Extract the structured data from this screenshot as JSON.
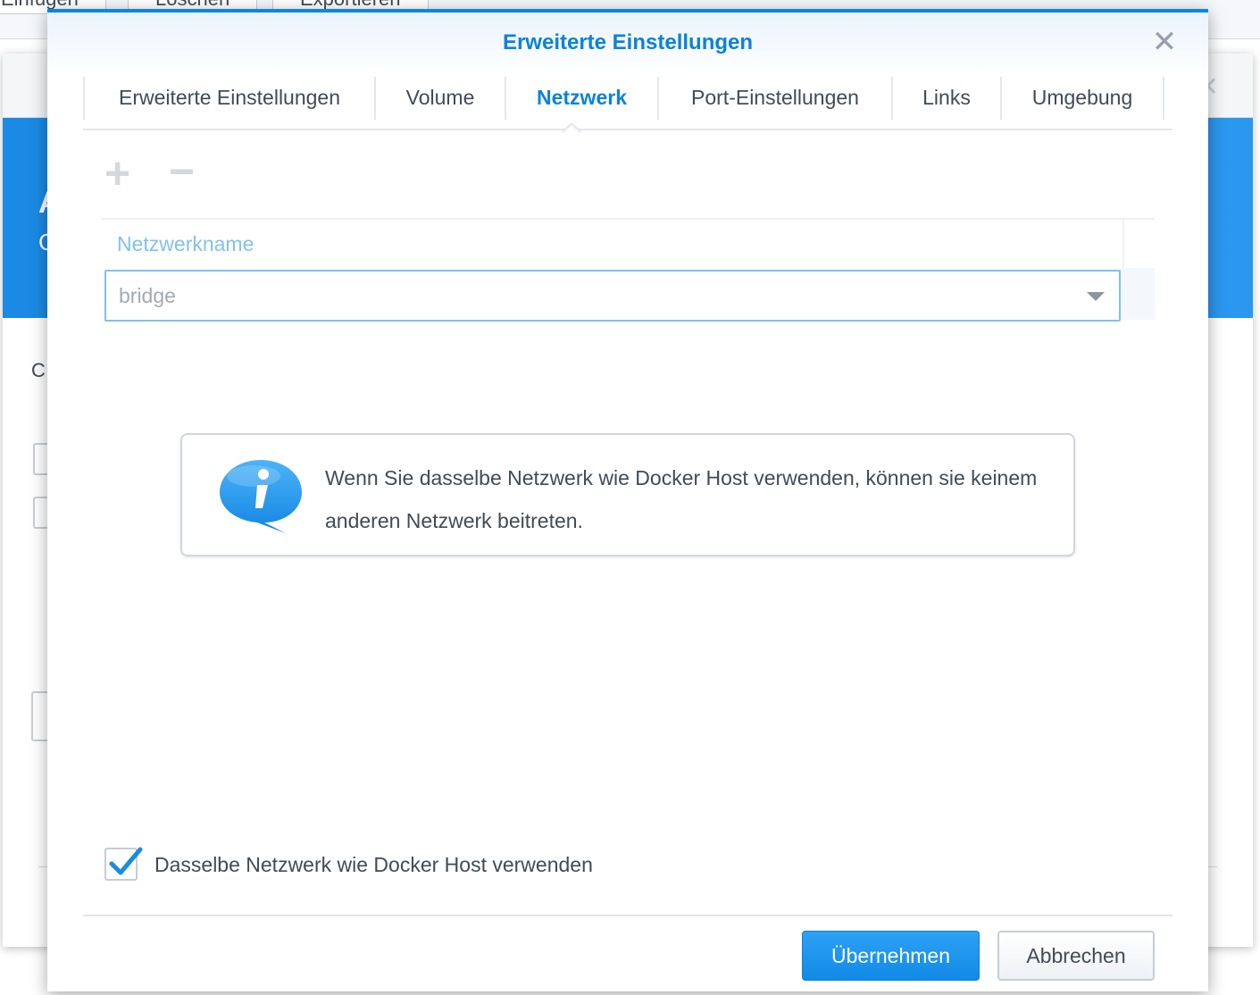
{
  "background": {
    "toolbar_items": [
      "Einfügen",
      "Löschen",
      "Exportieren"
    ],
    "panel_letters": [
      "A",
      "C"
    ],
    "panel_text": "C"
  },
  "dialog": {
    "title": "Erweiterte Einstellungen",
    "tabs": [
      {
        "label": "Erweiterte Einstellungen",
        "active": false
      },
      {
        "label": "Volume",
        "active": false
      },
      {
        "label": "Netzwerk",
        "active": true
      },
      {
        "label": "Port-Einstellungen",
        "active": false
      },
      {
        "label": "Links",
        "active": false
      },
      {
        "label": "Umgebung",
        "active": false
      }
    ],
    "icons": {
      "add": "plus-icon",
      "remove": "minus-icon",
      "close": "close-icon",
      "info": "info-bubble-icon",
      "check": "checkmark-icon"
    },
    "network_table": {
      "column_header": "Netzwerkname",
      "selected_network": "bridge"
    },
    "info_message": "Wenn Sie dasselbe Netzwerk wie Docker Host verwenden, können sie keinem anderen Netzwerk beitreten.",
    "host_network_checkbox": {
      "label": "Dasselbe Netzwerk wie Docker Host verwenden",
      "checked": true
    },
    "buttons": {
      "apply": "Übernehmen",
      "cancel": "Abbrechen"
    },
    "colors": {
      "accent": "#0b83d8",
      "primary_button": "#1a94ee",
      "header_label": "#81c2ee"
    }
  }
}
